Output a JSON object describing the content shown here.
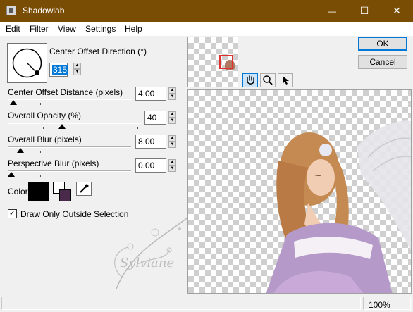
{
  "window": {
    "title": "Shadowlab",
    "minimize_glyph": "—",
    "maximize_glyph": "☐",
    "close_glyph": "✕"
  },
  "menu": [
    "Edit",
    "Filter",
    "View",
    "Settings",
    "Help"
  ],
  "controls": {
    "direction": {
      "label": "Center Offset Direction (°)",
      "value": "315"
    },
    "distance": {
      "label": "Center Offset Distance (pixels)",
      "value": "4.00",
      "level": 0.02
    },
    "opacity": {
      "label": "Overall Opacity (%)",
      "value": "40",
      "level": 0.4
    },
    "blur": {
      "label": "Overall Blur (pixels)",
      "value": "8.00",
      "level": 0.08
    },
    "perspective": {
      "label": "Perspective Blur (pixels)",
      "value": "0.00",
      "level": 0.0
    },
    "color": {
      "label": "Color",
      "primary": "#000000",
      "secondary": "#4a2a4a"
    },
    "draw_outside": {
      "label": "Draw Only Outside Selection",
      "checked": true
    }
  },
  "buttons": {
    "ok": "OK",
    "cancel": "Cancel"
  },
  "tools": [
    "hand-icon",
    "zoom-icon",
    "pointer-icon"
  ],
  "watermark": "Sylviane",
  "status": {
    "zoom": "100%"
  },
  "colors": {
    "titlebar": "#7a4d05",
    "accent": "#0078d7",
    "nav_rect": "#e03030"
  }
}
